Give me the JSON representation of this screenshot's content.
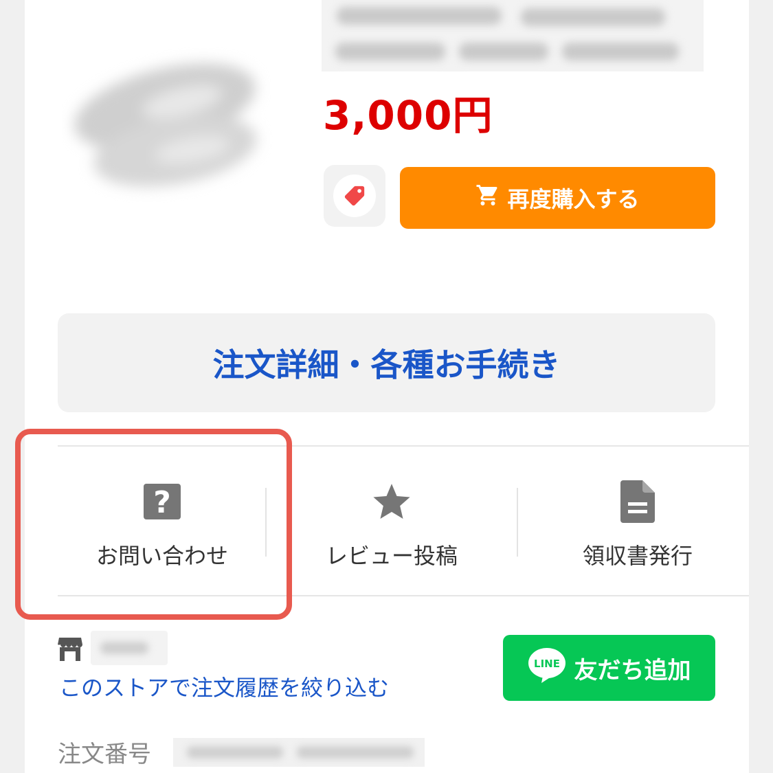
{
  "product": {
    "price": "3,000円"
  },
  "buttons": {
    "rebuy_label": "再度購入する",
    "order_details_label": "注文詳細・各種お手続き",
    "line_add_friend_label": "友だち追加",
    "line_logo_text": "LINE"
  },
  "actions": [
    {
      "label": "お問い合わせ",
      "icon": "question-icon"
    },
    {
      "label": "レビュー投稿",
      "icon": "star-icon"
    },
    {
      "label": "領収書発行",
      "icon": "document-icon"
    }
  ],
  "store": {
    "filter_link": "このストアで注文履歴を絞り込む",
    "icon": "store-icon"
  },
  "order": {
    "number_label": "注文番号"
  },
  "colors": {
    "price": "#dd0000",
    "rebuy_button": "#ff8a00",
    "link_blue": "#1a56c8",
    "line_green": "#06c755",
    "highlight": "#e85a4f",
    "coupon_tag": "#f04848"
  }
}
